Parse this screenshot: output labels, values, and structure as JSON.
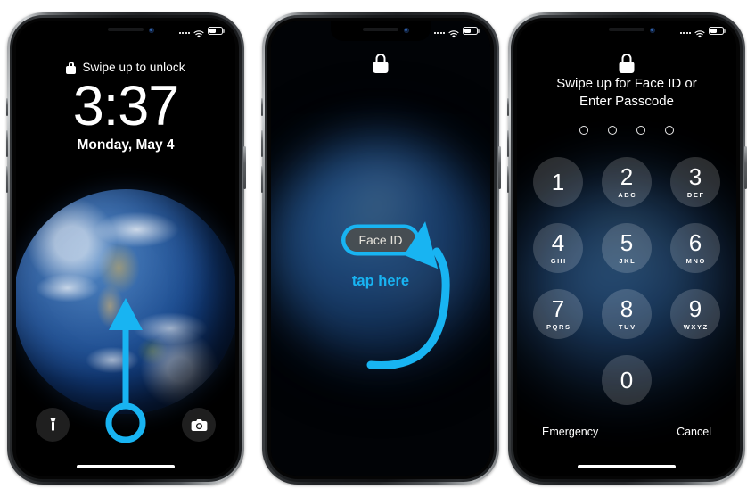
{
  "meta": {
    "accent_color": "#18B4F2",
    "background": "#ffffff"
  },
  "phones": [
    {
      "id": "lock-screen",
      "status_bar": {
        "signal_icon": "signal-dots-icon",
        "wifi_icon": "wifi-icon",
        "battery_icon": "battery-icon"
      },
      "lock_icon": "lock-icon",
      "hint": "Swipe up to unlock",
      "time": "3:37",
      "date": "Monday, May 4",
      "wallpaper": "earth-wallpaper",
      "quick_actions": [
        {
          "name": "flashlight-button",
          "icon": "flashlight-icon"
        },
        {
          "name": "camera-button",
          "icon": "camera-icon"
        }
      ],
      "annotation": {
        "type": "swipe-up-arrow",
        "color": "#18B4F2"
      },
      "home_indicator": true
    },
    {
      "id": "face-id-screen",
      "status_bar": {
        "signal_icon": "signal-dots-icon",
        "wifi_icon": "wifi-icon",
        "battery_icon": "battery-icon"
      },
      "lock_icon": "lock-icon",
      "face_id_label": "Face ID",
      "annotation_label": "tap here",
      "annotation": {
        "type": "curved-arrow",
        "color": "#18B4F2"
      }
    },
    {
      "id": "passcode-screen",
      "status_bar": {
        "signal_icon": "signal-dots-icon",
        "wifi_icon": "wifi-icon",
        "battery_icon": "battery-icon"
      },
      "lock_icon": "lock-icon",
      "title_line1": "Swipe up for Face ID or",
      "title_line2": "Enter Passcode",
      "passcode_dots": 4,
      "passcode_entered": 0,
      "keypad": [
        {
          "num": "1",
          "letters": ""
        },
        {
          "num": "2",
          "letters": "ABC"
        },
        {
          "num": "3",
          "letters": "DEF"
        },
        {
          "num": "4",
          "letters": "GHI"
        },
        {
          "num": "5",
          "letters": "JKL"
        },
        {
          "num": "6",
          "letters": "MNO"
        },
        {
          "num": "7",
          "letters": "PQRS"
        },
        {
          "num": "8",
          "letters": "TUV"
        },
        {
          "num": "9",
          "letters": "WXYZ"
        },
        {
          "num": "0",
          "letters": ""
        }
      ],
      "emergency_label": "Emergency",
      "cancel_label": "Cancel",
      "home_indicator": true
    }
  ]
}
